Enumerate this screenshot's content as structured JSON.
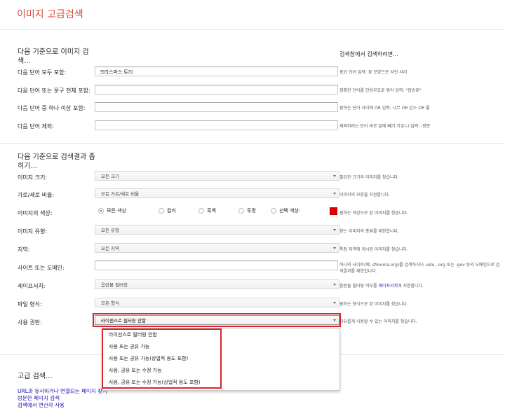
{
  "page": {
    "title": "이미지 고급검색"
  },
  "section1": {
    "heading": "다음 기준으로 이미지 검색...",
    "side_heading": "검색창에서 검색하려면...",
    "rows": [
      {
        "label": "다음 단어 모두 포함:",
        "value": "크리스마스 트리",
        "hint": "중요 단어 입력: 꽃 모양으로 서린 서리"
      },
      {
        "label": "다음 단어 또는 문구 전체 포함:",
        "value": "",
        "hint": "정확한 단어를 인용부호로 묶어 입력: \"장승꽃\""
      },
      {
        "label": "다음 단어 중 하나 이상 포함:",
        "value": "",
        "hint": "원하는 단어 사이에 OR 입력: 나무 OR 감소 OR 풀"
      },
      {
        "label": "다음 단어 제외:",
        "value": "",
        "hint": "제외하려는 단어 바로 앞에 빼기 기호(-) 입력: -향문"
      }
    ]
  },
  "section2": {
    "heading": "다음 기준으로 검색결과 좁히기...",
    "image_size": {
      "label": "이미지 크기:",
      "value": "모든 크기",
      "hint": "필요한 크기의 이미지를 찾습니다."
    },
    "aspect_ratio": {
      "label": "가로/세로 비율:",
      "value": "모든 가로/세로 비율",
      "hint": "이미지의 모양을 지정합니다."
    },
    "color": {
      "label": "이미지의 색상:",
      "options": [
        "모든 색상",
        "컬러",
        "흑백",
        "투명",
        "선택 색상:"
      ],
      "selected": "모든 색상",
      "swatch": "#e00000",
      "hint": "원하는 색상으로 된 이미지를 찾습니다."
    },
    "image_type": {
      "label": "이미지 유형:",
      "value": "모든 유형",
      "hint": "찾는 이미지의 종류를 제한합니다."
    },
    "region": {
      "label": "지역:",
      "value": "모든 지역",
      "hint": "특정 지역에 게시된 이미지를 찾습니다."
    },
    "site": {
      "label": "사이트 또는 도메인:",
      "value": "",
      "hint": "하나의 사이트(예: sfmoma.org)를 검색하거나 .edu, .org 또는 .gov 등의 도메인으로 검색결과를 제한합니다."
    },
    "safesearch": {
      "label": "세이프서치:",
      "value": "음란물 필터링",
      "hint_prefix": "음란물 필터링 여부를 ",
      "hint_link": "세이프서치",
      "hint_suffix": "에 지정합니다."
    },
    "file_type": {
      "label": "파일 형식:",
      "value": "모든 형식",
      "hint": "원하는 형식으로 된 이미지를 찾습니다."
    },
    "usage_rights": {
      "label": "사용 권한:",
      "value": "라이센스로 필터링 안함",
      "hint": "자유롭게 사용할 수 있는 이미지를 찾습니다.",
      "options": [
        "라이선스로 필터링 안함",
        "사용 또는 공유 가능",
        "사용 또는 공유 가능(상업적 용도 포함)",
        "사용, 공유 또는 수정 가능",
        "사용, 공유 또는 수정 가능(상업적 용도 포함)"
      ]
    }
  },
  "section3": {
    "heading": "고급 검색...",
    "links": [
      "URL과 유사하거나 연결되는 페이지 찾기",
      "방문한 페이지 검색",
      "검색에서 연산자 사용"
    ]
  },
  "colors": {
    "title": "#dd4b39",
    "highlight": "#d6262e",
    "link": "#1a0dab"
  }
}
